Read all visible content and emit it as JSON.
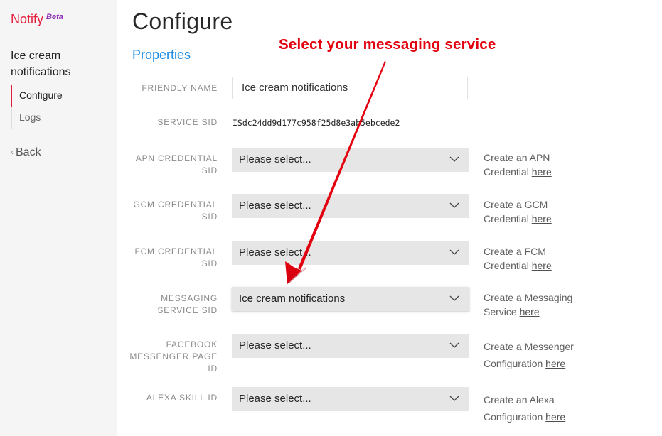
{
  "sidebar": {
    "brand": "Notify",
    "brand_badge": "Beta",
    "service_name": "Ice cream notifications",
    "nav": [
      {
        "label": "Configure",
        "active": true
      },
      {
        "label": "Logs",
        "active": false
      }
    ],
    "back_label": "Back"
  },
  "page": {
    "title": "Configure",
    "section": "Properties"
  },
  "annotation": {
    "text": "Select your messaging service",
    "color": "#e3000f"
  },
  "form": {
    "friendly_name": {
      "label": "FRIENDLY NAME",
      "value": "Ice cream notifications"
    },
    "service_sid": {
      "label": "SERVICE SID",
      "value": "ISdc24dd9d177c958f25d8e3ab5ebcede2"
    },
    "fields": [
      {
        "label": "APN CREDENTIAL SID",
        "selected": "Please select...",
        "help_text": "Create an APN Credential",
        "help_link": "here"
      },
      {
        "label": "GCM CREDENTIAL SID",
        "selected": "Please select...",
        "help_text": "Create a GCM Credential",
        "help_link": "here"
      },
      {
        "label": "FCM CREDENTIAL SID",
        "selected": "Please select...",
        "help_text": "Create a FCM Credential",
        "help_link": "here"
      },
      {
        "label": "MESSAGING SERVICE SID",
        "selected": "Ice cream notifications",
        "help_text": "Create a Messaging Service",
        "help_link": "here"
      },
      {
        "label": "FACEBOOK MESSENGER PAGE ID",
        "selected": "Please select...",
        "help_text": "Create a Messenger Configuration",
        "help_link": "here"
      },
      {
        "label": "ALEXA SKILL ID",
        "selected": "Please select...",
        "help_text": "Create an Alexa Configuration",
        "help_link": "here"
      }
    ]
  },
  "colors": {
    "brand": "#e31e3c",
    "beta": "#8e2fb5",
    "link_blue": "#1a8ce6",
    "select_bg": "#e6e6e6"
  }
}
